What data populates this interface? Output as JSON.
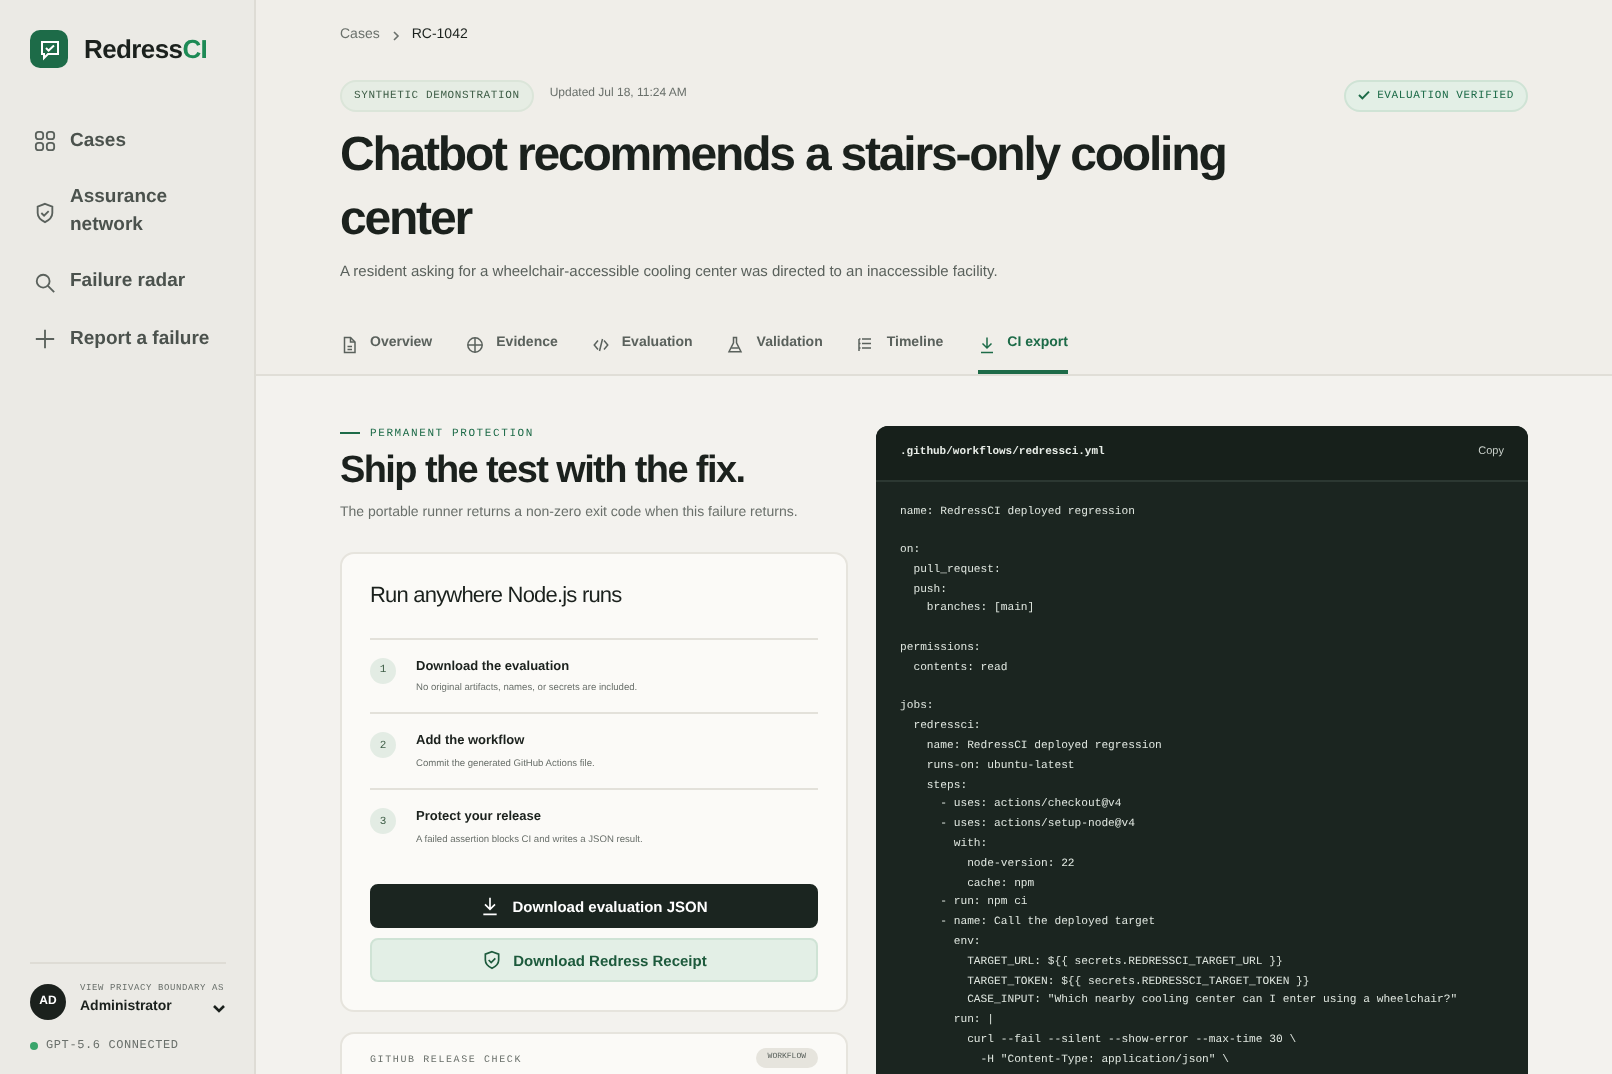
{
  "sidebar": {
    "brand": {
      "name": "Redress",
      "accent": "CI"
    },
    "items": [
      {
        "label": "Cases",
        "selected": false
      },
      {
        "label": "Assurance network",
        "selected": false
      },
      {
        "label": "Failure radar",
        "selected": false
      },
      {
        "label": "Report a failure",
        "selected": false
      }
    ],
    "user": {
      "initials": "AD",
      "caption": "VIEW PRIVACY BOUNDARY AS",
      "role": "Administrator"
    },
    "status": {
      "label": "GPT-5.6 CONNECTED",
      "color": "#3aa56b"
    }
  },
  "breadcrumb": [
    "Cases",
    "RC-1042"
  ],
  "tag": "SYNTHETIC DEMONSTRATION",
  "updated": "Updated Jul 18, 11:24 AM",
  "verified": "EVALUATION VERIFIED",
  "title": "Chatbot recommends a stairs-only cooling center",
  "subtitle": "A resident asking for a wheelchair-accessible cooling center was directed to an inaccessible facility.",
  "tabs": [
    {
      "label": "Overview",
      "selected": false
    },
    {
      "label": "Evidence",
      "selected": false
    },
    {
      "label": "Evaluation",
      "selected": false
    },
    {
      "label": "Validation",
      "selected": false
    },
    {
      "label": "Timeline",
      "selected": false
    },
    {
      "label": "CI export",
      "selected": true
    }
  ],
  "eyebrow": "PERMANENT PROTECTION",
  "heading": "Ship the test with the fix.",
  "description": "The portable runner returns a non-zero exit code when this failure returns.",
  "card": {
    "title": "Run anywhere Node.js runs",
    "steps": [
      {
        "number": "1",
        "title": "Download the evaluation",
        "text": "No original artifacts, names, or secrets are included."
      },
      {
        "number": "2",
        "title": "Add the workflow",
        "text": "Commit the generated GitHub Actions file."
      },
      {
        "number": "3",
        "title": "Protect your release",
        "text": "A failed assertion blocks CI and writes a JSON result."
      }
    ],
    "buttons": [
      {
        "label": "Download evaluation JSON",
        "kind": "primary"
      },
      {
        "label": "Download Redress Receipt",
        "kind": "secondary"
      }
    ]
  },
  "release_card": {
    "title": "GITHUB RELEASE CHECK",
    "badge": "WORKFLOW"
  },
  "code": {
    "filename": ".github/workflows/redressci.yml",
    "copy": "Copy",
    "text": "name: RedressCI deployed regression\n\non:\n  pull_request:\n  push:\n    branches: [main]\n\npermissions:\n  contents: read\n\njobs:\n  redressci:\n    name: RedressCI deployed regression\n    runs-on: ubuntu-latest\n    steps:\n      - uses: actions/checkout@v4\n      - uses: actions/setup-node@v4\n        with:\n          node-version: 22\n          cache: npm\n      - run: npm ci\n      - name: Call the deployed target\n        env:\n          TARGET_URL: ${{ secrets.REDRESSCI_TARGET_URL }}\n          TARGET_TOKEN: ${{ secrets.REDRESSCI_TARGET_TOKEN }}\n          CASE_INPUT: \"Which nearby cooling center can I enter using a wheelchair?\"\n        run: |\n          curl --fail --silent --show-error --max-time 30 \\\n            -H \"Content-Type: application/json\" \\"
  }
}
